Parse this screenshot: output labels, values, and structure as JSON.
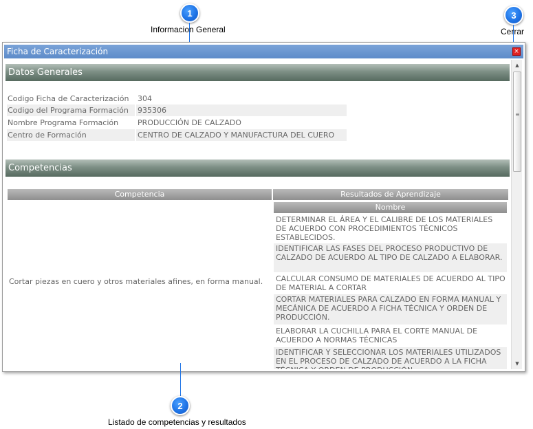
{
  "callouts": [
    {
      "num": "1",
      "label": "Informacion General"
    },
    {
      "num": "2",
      "label": "Listado de competencias y resultados"
    },
    {
      "num": "3",
      "label": "Cerrar"
    }
  ],
  "window": {
    "title": "Ficha de Caracterización",
    "close_icon": "close-icon",
    "close_glyph": "×"
  },
  "datos_generales": {
    "title": "Datos Generales",
    "fields": [
      {
        "label": "Codigo Ficha de Caracterización",
        "value": "304"
      },
      {
        "label": "Codigo del Programa Formación",
        "value": "935306"
      },
      {
        "label": "Nombre Programa Formación",
        "value": "PRODUCCIÓN DE CALZADO"
      },
      {
        "label": "Centro de Formación",
        "value": "CENTRO DE CALZADO Y MANUFACTURA DEL CUERO"
      }
    ]
  },
  "competencias": {
    "title": "Competencias",
    "columns": {
      "competencia": "Competencia",
      "resultados": "Resultados de Aprendizaje",
      "nombre": "Nombre"
    },
    "rows": [
      {
        "competencia": "Cortar piezas en cuero y otros materiales afines, en forma manual.",
        "resultados": [
          "DETERMINAR EL ÁREA Y EL CALIBRE DE LOS MATERIALES DE ACUERDO CON PROCEDIMIENTOS TÉCNICOS ESTABLECIDOS.",
          "IDENTIFICAR LAS FASES DEL PROCESO PRODUCTIVO DE CALZADO DE ACUERDO AL TIPO DE CALZADO A ELABORAR.",
          "CALCULAR CONSUMO DE MATERIALES DE ACUERDO AL TIPO DE MATERIAL A CORTAR",
          "CORTAR MATERIALES PARA CALZADO EN FORMA MANUAL Y MECÁNICA DE ACUERDO A FICHA TÉCNICA Y ORDEN DE PRODUCCIÓN.",
          "ELABORAR LA CUCHILLA PARA EL CORTE MANUAL DE ACUERDO A NORMAS TÉCNICAS",
          "IDENTIFICAR Y SELECCIONAR LOS MATERIALES UTILIZADOS EN EL PROCESO DE CALZADO DE ACUERDO A LA FICHA TÉCNICA Y ORDEN DE PRODUCCIÓN."
        ]
      }
    ]
  },
  "scrollbar": {
    "up_glyph": "▲",
    "down_glyph": "▼",
    "grip_glyph": "≡"
  }
}
